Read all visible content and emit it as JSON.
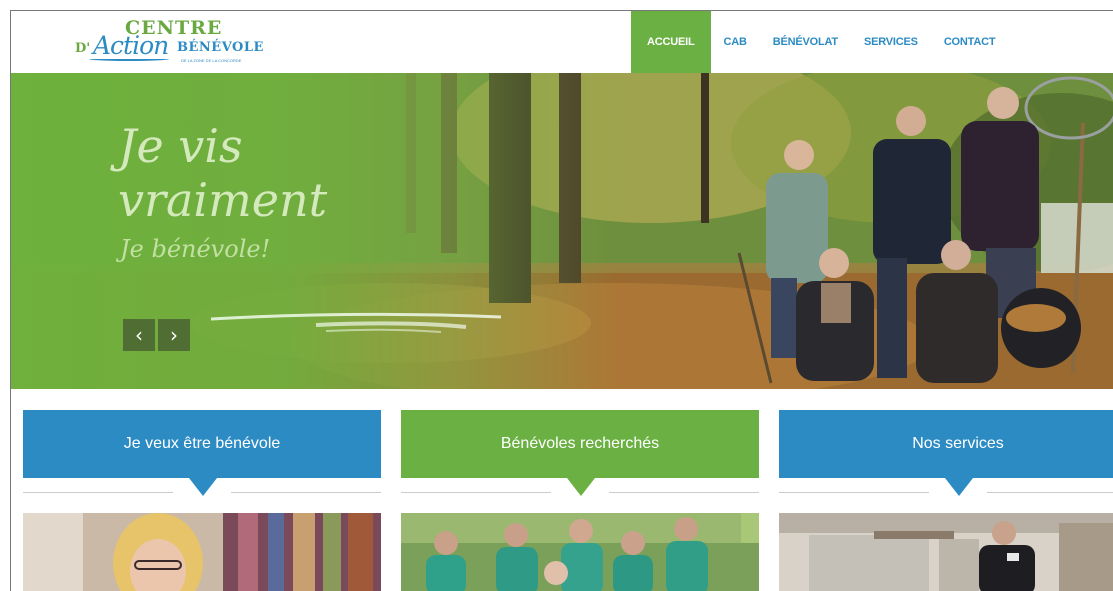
{
  "logo": {
    "centre": "CENTRE",
    "d": "D'",
    "action": "Action",
    "benevole": "BÉNÉVOLE",
    "tagline": "DE LA ZONE DE LA CONCORDE"
  },
  "nav": {
    "items": [
      {
        "label": "ACCUEIL",
        "active": true
      },
      {
        "label": "CAB",
        "active": false
      },
      {
        "label": "BÉNÉVOLAT",
        "active": false
      },
      {
        "label": "SERVICES",
        "active": false
      },
      {
        "label": "CONTACT",
        "active": false
      }
    ]
  },
  "hero": {
    "line1": "Je vis",
    "line2": "vraiment",
    "line3": "Je bénévole!",
    "prev_label": "‹",
    "next_label": "›"
  },
  "cards": [
    {
      "title": "Je veux être bénévole",
      "color": "#2d8bc4"
    },
    {
      "title": "Bénévoles recherchés",
      "color": "#6ab043"
    },
    {
      "title": "Nos services",
      "color": "#2d8bc4"
    }
  ],
  "colors": {
    "brand_green": "#6ab043",
    "brand_blue": "#2d8bc4"
  }
}
